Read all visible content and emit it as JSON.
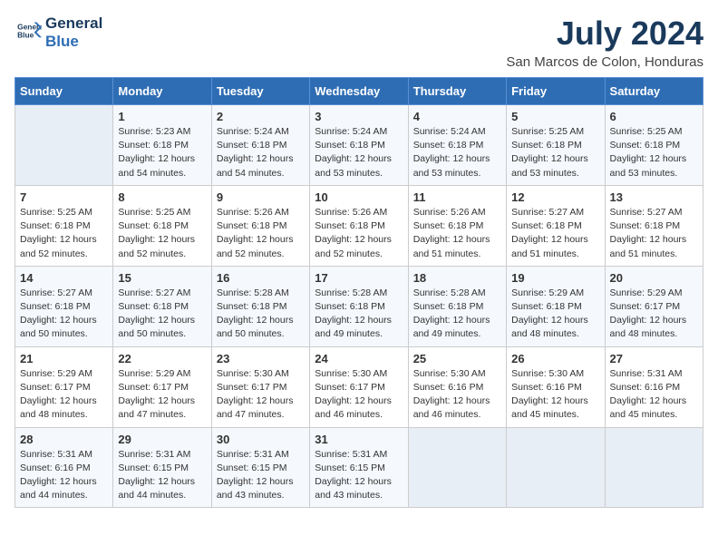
{
  "logo": {
    "line1": "General",
    "line2": "Blue"
  },
  "title": "July 2024",
  "location": "San Marcos de Colon, Honduras",
  "days_of_week": [
    "Sunday",
    "Monday",
    "Tuesday",
    "Wednesday",
    "Thursday",
    "Friday",
    "Saturday"
  ],
  "weeks": [
    [
      {
        "day": "",
        "sunrise": "",
        "sunset": "",
        "daylight": ""
      },
      {
        "day": "1",
        "sunrise": "Sunrise: 5:23 AM",
        "sunset": "Sunset: 6:18 PM",
        "daylight": "Daylight: 12 hours and 54 minutes."
      },
      {
        "day": "2",
        "sunrise": "Sunrise: 5:24 AM",
        "sunset": "Sunset: 6:18 PM",
        "daylight": "Daylight: 12 hours and 54 minutes."
      },
      {
        "day": "3",
        "sunrise": "Sunrise: 5:24 AM",
        "sunset": "Sunset: 6:18 PM",
        "daylight": "Daylight: 12 hours and 53 minutes."
      },
      {
        "day": "4",
        "sunrise": "Sunrise: 5:24 AM",
        "sunset": "Sunset: 6:18 PM",
        "daylight": "Daylight: 12 hours and 53 minutes."
      },
      {
        "day": "5",
        "sunrise": "Sunrise: 5:25 AM",
        "sunset": "Sunset: 6:18 PM",
        "daylight": "Daylight: 12 hours and 53 minutes."
      },
      {
        "day": "6",
        "sunrise": "Sunrise: 5:25 AM",
        "sunset": "Sunset: 6:18 PM",
        "daylight": "Daylight: 12 hours and 53 minutes."
      }
    ],
    [
      {
        "day": "7",
        "sunrise": "Sunrise: 5:25 AM",
        "sunset": "Sunset: 6:18 PM",
        "daylight": "Daylight: 12 hours and 52 minutes."
      },
      {
        "day": "8",
        "sunrise": "Sunrise: 5:25 AM",
        "sunset": "Sunset: 6:18 PM",
        "daylight": "Daylight: 12 hours and 52 minutes."
      },
      {
        "day": "9",
        "sunrise": "Sunrise: 5:26 AM",
        "sunset": "Sunset: 6:18 PM",
        "daylight": "Daylight: 12 hours and 52 minutes."
      },
      {
        "day": "10",
        "sunrise": "Sunrise: 5:26 AM",
        "sunset": "Sunset: 6:18 PM",
        "daylight": "Daylight: 12 hours and 52 minutes."
      },
      {
        "day": "11",
        "sunrise": "Sunrise: 5:26 AM",
        "sunset": "Sunset: 6:18 PM",
        "daylight": "Daylight: 12 hours and 51 minutes."
      },
      {
        "day": "12",
        "sunrise": "Sunrise: 5:27 AM",
        "sunset": "Sunset: 6:18 PM",
        "daylight": "Daylight: 12 hours and 51 minutes."
      },
      {
        "day": "13",
        "sunrise": "Sunrise: 5:27 AM",
        "sunset": "Sunset: 6:18 PM",
        "daylight": "Daylight: 12 hours and 51 minutes."
      }
    ],
    [
      {
        "day": "14",
        "sunrise": "Sunrise: 5:27 AM",
        "sunset": "Sunset: 6:18 PM",
        "daylight": "Daylight: 12 hours and 50 minutes."
      },
      {
        "day": "15",
        "sunrise": "Sunrise: 5:27 AM",
        "sunset": "Sunset: 6:18 PM",
        "daylight": "Daylight: 12 hours and 50 minutes."
      },
      {
        "day": "16",
        "sunrise": "Sunrise: 5:28 AM",
        "sunset": "Sunset: 6:18 PM",
        "daylight": "Daylight: 12 hours and 50 minutes."
      },
      {
        "day": "17",
        "sunrise": "Sunrise: 5:28 AM",
        "sunset": "Sunset: 6:18 PM",
        "daylight": "Daylight: 12 hours and 49 minutes."
      },
      {
        "day": "18",
        "sunrise": "Sunrise: 5:28 AM",
        "sunset": "Sunset: 6:18 PM",
        "daylight": "Daylight: 12 hours and 49 minutes."
      },
      {
        "day": "19",
        "sunrise": "Sunrise: 5:29 AM",
        "sunset": "Sunset: 6:18 PM",
        "daylight": "Daylight: 12 hours and 48 minutes."
      },
      {
        "day": "20",
        "sunrise": "Sunrise: 5:29 AM",
        "sunset": "Sunset: 6:17 PM",
        "daylight": "Daylight: 12 hours and 48 minutes."
      }
    ],
    [
      {
        "day": "21",
        "sunrise": "Sunrise: 5:29 AM",
        "sunset": "Sunset: 6:17 PM",
        "daylight": "Daylight: 12 hours and 48 minutes."
      },
      {
        "day": "22",
        "sunrise": "Sunrise: 5:29 AM",
        "sunset": "Sunset: 6:17 PM",
        "daylight": "Daylight: 12 hours and 47 minutes."
      },
      {
        "day": "23",
        "sunrise": "Sunrise: 5:30 AM",
        "sunset": "Sunset: 6:17 PM",
        "daylight": "Daylight: 12 hours and 47 minutes."
      },
      {
        "day": "24",
        "sunrise": "Sunrise: 5:30 AM",
        "sunset": "Sunset: 6:17 PM",
        "daylight": "Daylight: 12 hours and 46 minutes."
      },
      {
        "day": "25",
        "sunrise": "Sunrise: 5:30 AM",
        "sunset": "Sunset: 6:16 PM",
        "daylight": "Daylight: 12 hours and 46 minutes."
      },
      {
        "day": "26",
        "sunrise": "Sunrise: 5:30 AM",
        "sunset": "Sunset: 6:16 PM",
        "daylight": "Daylight: 12 hours and 45 minutes."
      },
      {
        "day": "27",
        "sunrise": "Sunrise: 5:31 AM",
        "sunset": "Sunset: 6:16 PM",
        "daylight": "Daylight: 12 hours and 45 minutes."
      }
    ],
    [
      {
        "day": "28",
        "sunrise": "Sunrise: 5:31 AM",
        "sunset": "Sunset: 6:16 PM",
        "daylight": "Daylight: 12 hours and 44 minutes."
      },
      {
        "day": "29",
        "sunrise": "Sunrise: 5:31 AM",
        "sunset": "Sunset: 6:15 PM",
        "daylight": "Daylight: 12 hours and 44 minutes."
      },
      {
        "day": "30",
        "sunrise": "Sunrise: 5:31 AM",
        "sunset": "Sunset: 6:15 PM",
        "daylight": "Daylight: 12 hours and 43 minutes."
      },
      {
        "day": "31",
        "sunrise": "Sunrise: 5:31 AM",
        "sunset": "Sunset: 6:15 PM",
        "daylight": "Daylight: 12 hours and 43 minutes."
      },
      {
        "day": "",
        "sunrise": "",
        "sunset": "",
        "daylight": ""
      },
      {
        "day": "",
        "sunrise": "",
        "sunset": "",
        "daylight": ""
      },
      {
        "day": "",
        "sunrise": "",
        "sunset": "",
        "daylight": ""
      }
    ]
  ]
}
